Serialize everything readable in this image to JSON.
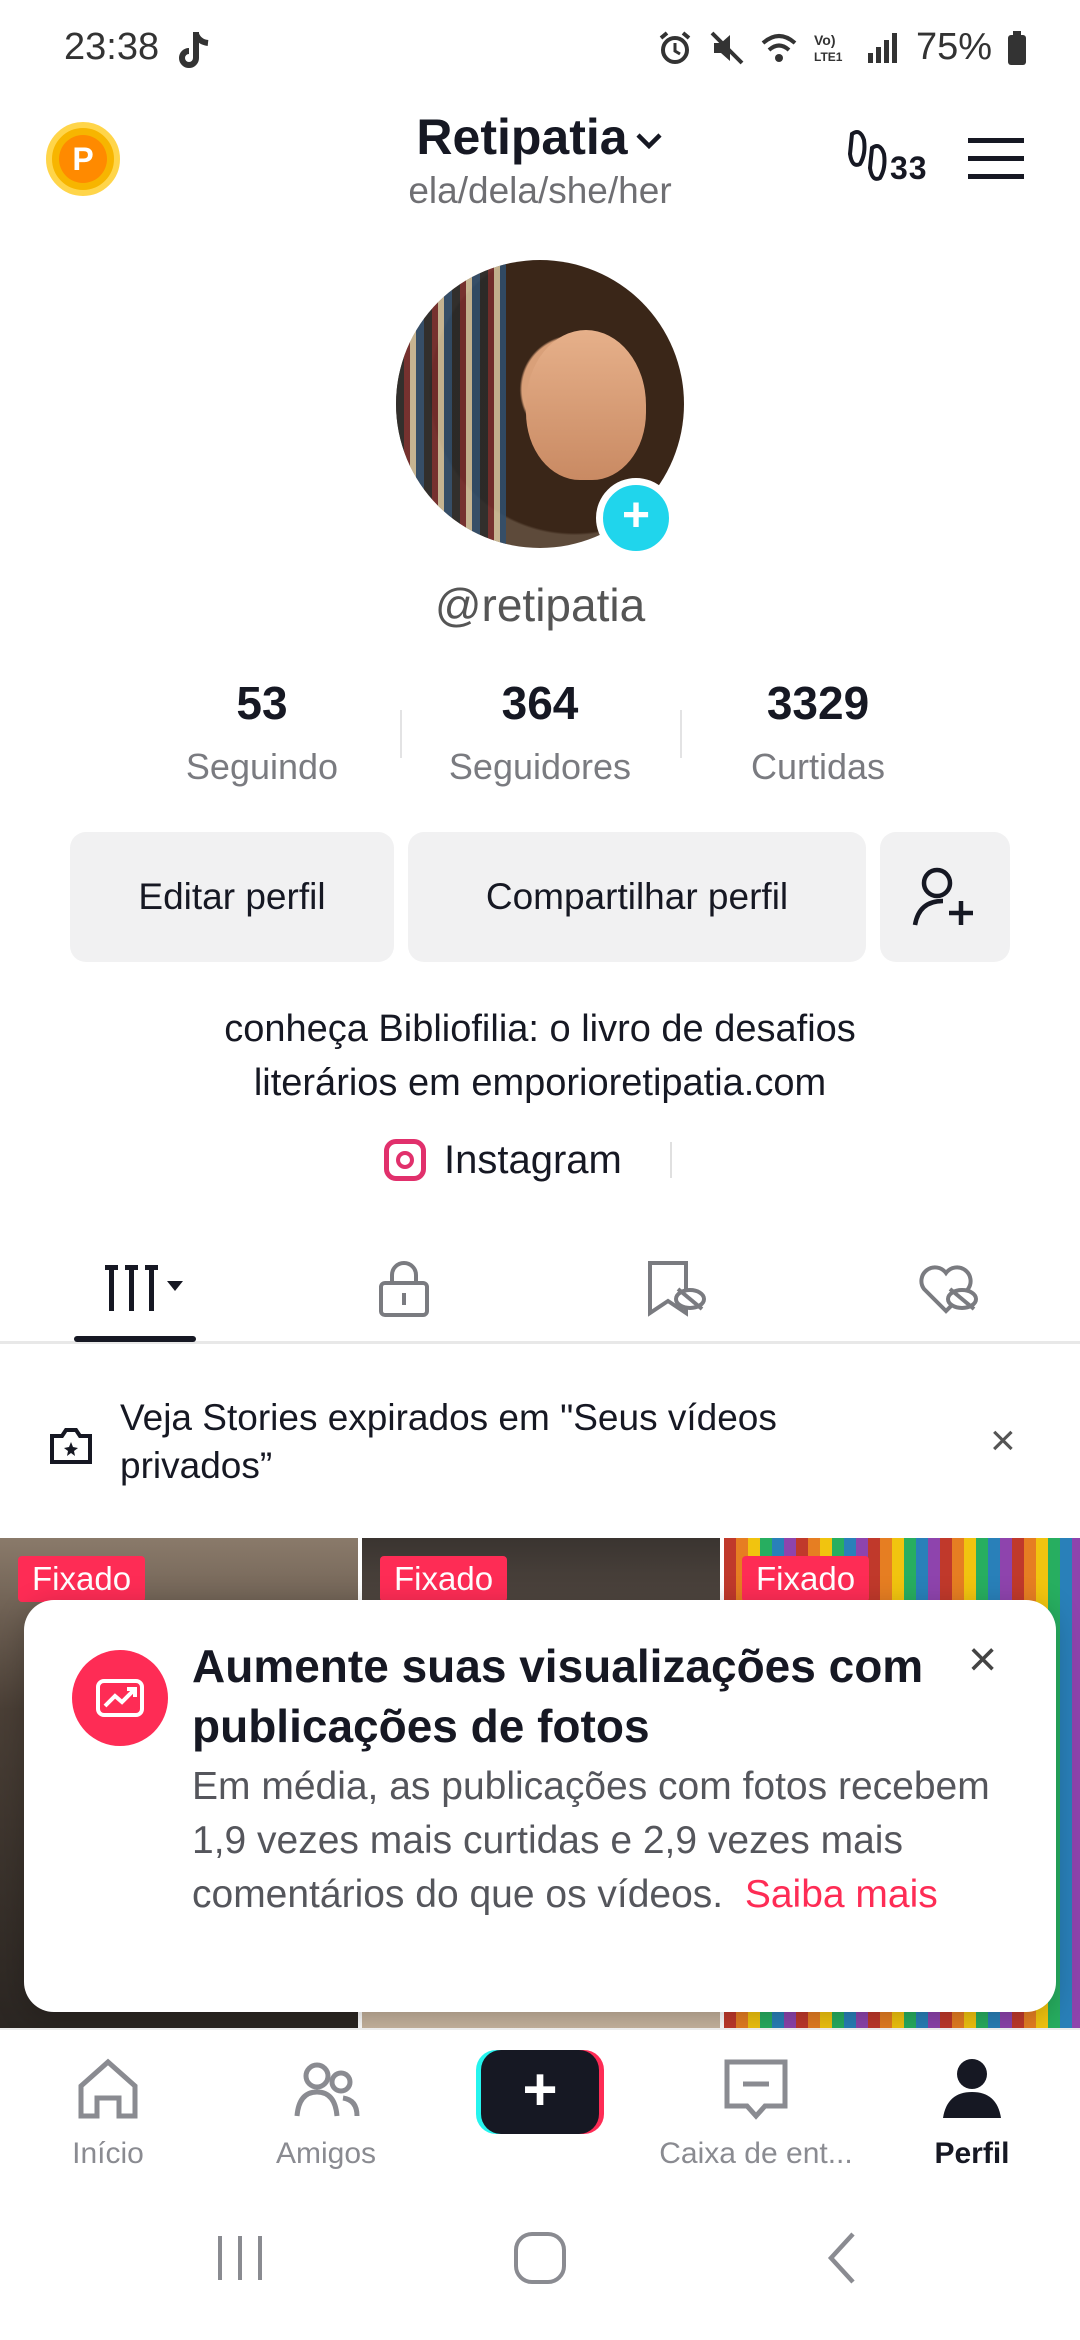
{
  "status_bar": {
    "time": "23:38",
    "battery": "75%"
  },
  "header": {
    "username": "Retipatia",
    "pronouns": "ela/dela/she/her",
    "visitors_count": "33"
  },
  "profile": {
    "handle": "@retipatia",
    "stats": [
      {
        "value": "53",
        "label": "Seguindo"
      },
      {
        "value": "364",
        "label": "Seguidores"
      },
      {
        "value": "3329",
        "label": "Curtidas"
      }
    ],
    "buttons": {
      "edit": "Editar perfil",
      "share": "Compartilhar perfil"
    },
    "bio_line1": "conheça Bibliofilia: o livro de desafios",
    "bio_line2": "literários em emporioretipatia.com",
    "instagram": "Instagram"
  },
  "stories_banner": {
    "text": "Veja Stories expirados em \"Seus vídeos privados”"
  },
  "grid": {
    "pinned_label": "Fixado"
  },
  "popup": {
    "title": "Aumente suas visualizações com publicações de fotos",
    "body": "Em média, as publicações com fotos recebem 1,9 vezes mais curtidas e 2,9 vezes mais comentários do que os vídeos.",
    "link": "Saiba mais"
  },
  "bottom_nav": [
    {
      "label": "Início"
    },
    {
      "label": "Amigos"
    },
    {
      "label": "Caixa de ent..."
    },
    {
      "label": "Perfil"
    }
  ],
  "colors": {
    "accent": "#fe2c55",
    "cyan": "#25f4ee",
    "text": "#161823",
    "muted": "#7a7b80"
  }
}
